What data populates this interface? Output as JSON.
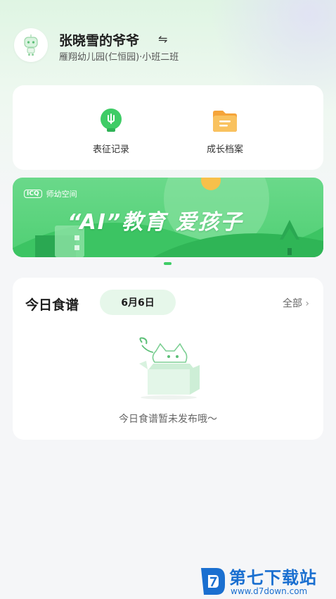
{
  "header": {
    "user_name": "张晓雪的爷爷",
    "school_class": "雁翔幼儿园(仁恒园)·小班二班",
    "switch_icon": "⇋"
  },
  "quick_links": [
    {
      "label": "表征记录",
      "icon": "lightbulb-icon",
      "color": "#3fcc66"
    },
    {
      "label": "成长档案",
      "icon": "folder-icon",
      "color": "#f5a43a"
    }
  ],
  "banner": {
    "brand": "师幼空间",
    "brand_logo_text": "ICQ",
    "title": "“AI”教育  爱孩子"
  },
  "menu_card": {
    "title": "今日食谱",
    "date": "6月6日",
    "view_all": "全部",
    "empty_text": "今日食谱暂未发布哦～"
  },
  "watermark": {
    "title": "第七下载站",
    "url": "www.d7down.com"
  },
  "colors": {
    "accent_green": "#3fcc66",
    "pill_bg": "#e6f7ea",
    "watermark_blue": "#1a6fd0"
  }
}
